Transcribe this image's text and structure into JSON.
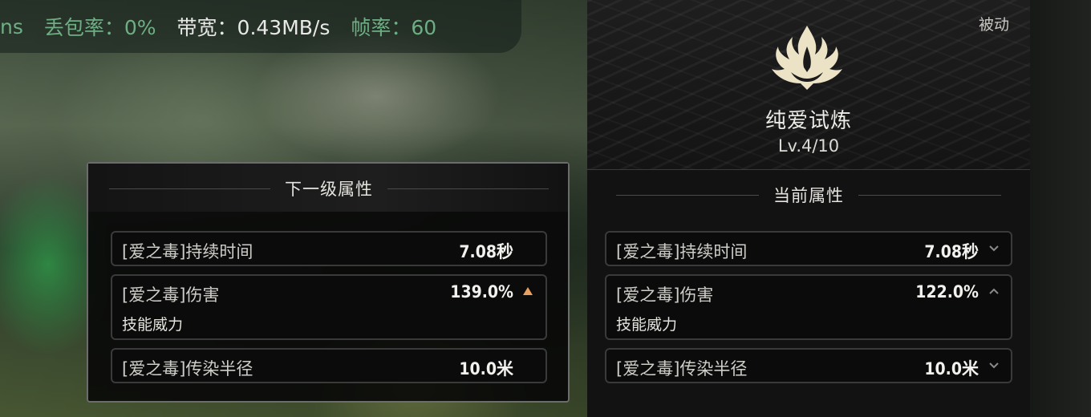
{
  "netbar": {
    "ping": "ns",
    "loss": "丢包率：0%",
    "bandwidth": "带宽：0.43MB/s",
    "fps": "帧率：60"
  },
  "skill": {
    "tag": "被动",
    "name": "纯爱试炼",
    "level": "Lv.4/10",
    "icon": "flame-crown-icon"
  },
  "next_level": {
    "title": "下一级属性",
    "rows": [
      {
        "label": "[爱之毒]持续时间",
        "value": "7.08秒"
      },
      {
        "label": "[爱之毒]伤害",
        "value": "139.0%",
        "sub": "技能威力",
        "indicator": "up-arrow-orange"
      },
      {
        "label": "[爱之毒]传染半径",
        "value": "10.0米"
      }
    ]
  },
  "current": {
    "title": "当前属性",
    "rows": [
      {
        "label": "[爱之毒]持续时间",
        "value": "7.08秒",
        "indicator": "chevron-down"
      },
      {
        "label": "[爱之毒]伤害",
        "value": "122.0%",
        "sub": "技能威力",
        "indicator": "chevron-up"
      },
      {
        "label": "[爱之毒]传染半径",
        "value": "10.0米",
        "indicator": "chevron-down"
      }
    ]
  },
  "colors": {
    "accent_green": "#6fae85",
    "up_arrow": "#e8a060",
    "panel_border": "#6c6c6c"
  }
}
